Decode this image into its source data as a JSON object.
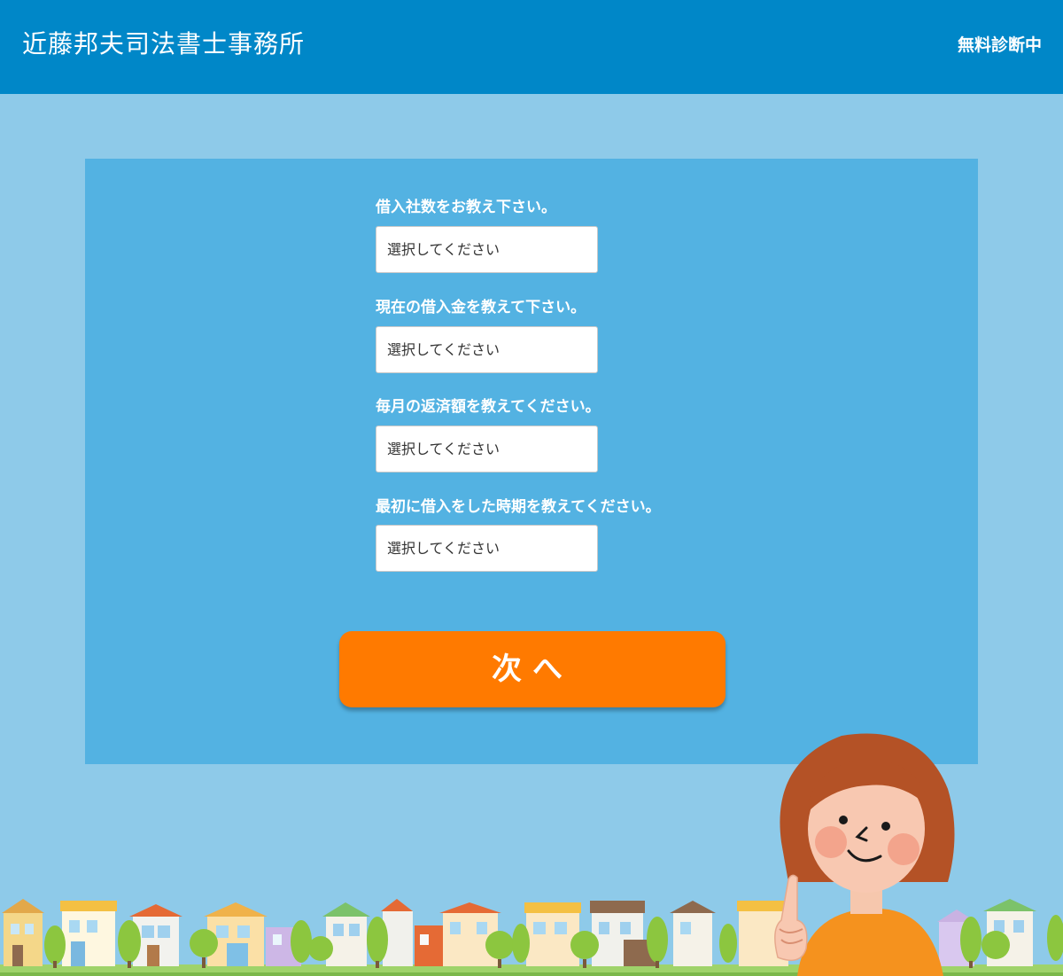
{
  "header": {
    "title": "近藤邦夫司法書士事務所",
    "status": "無料診断中"
  },
  "form": {
    "questions": [
      {
        "label": "借入社数をお教え下さい。",
        "value": "選択してください"
      },
      {
        "label": "現在の借入金を教えて下さい。",
        "value": "選択してください"
      },
      {
        "label": "毎月の返済額を教えてください。",
        "value": "選択してください"
      },
      {
        "label": "最初に借入をした時期を教えてください。",
        "value": "選択してください"
      }
    ],
    "next_label": "次へ"
  },
  "colors": {
    "header": "#0087c8",
    "page_background": "#8ecae9",
    "panel": "#53b2e2",
    "button": "#ff7a00"
  },
  "illustrations": {
    "town": "town-illustration",
    "person": "woman-pointing-illustration"
  }
}
